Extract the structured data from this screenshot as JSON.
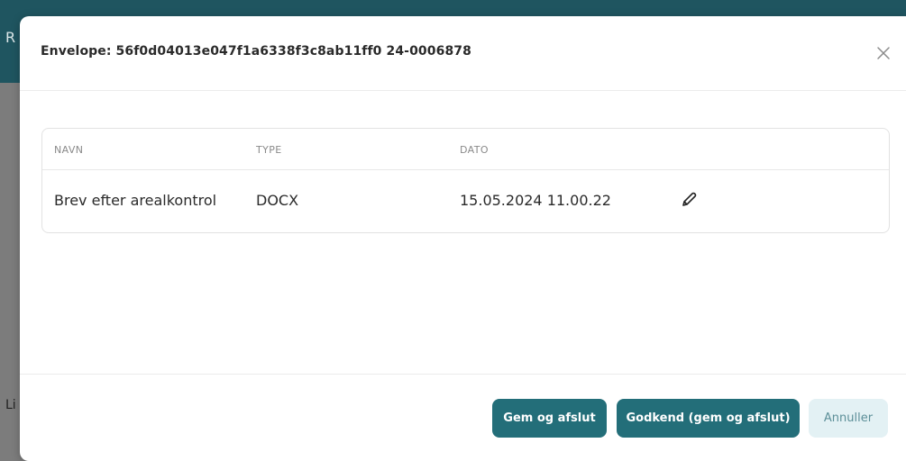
{
  "background": {
    "header_fragment": "R",
    "body_fragment": "Li"
  },
  "modal": {
    "title": "Envelope: 56f0d04013e047f1a6338f3c8ab11ff0 24-0006878",
    "close_icon": "close-icon"
  },
  "table": {
    "headers": [
      "NAVN",
      "TYPE",
      "DATO"
    ],
    "rows": [
      {
        "navn": "Brev efter arealkontrol",
        "type": "DOCX",
        "dato": "15.05.2024 11.00.22",
        "action_icon": "pencil-icon"
      }
    ]
  },
  "footer": {
    "save_label": "Gem og afslut",
    "approve_label": "Godkend (gem og afslut)",
    "cancel_label": "Annuller"
  },
  "colors": {
    "primary": "#236e79",
    "secondary_bg": "#e3f1f4",
    "secondary_text": "#5c8f98",
    "backdrop": "#7c7c7c"
  }
}
